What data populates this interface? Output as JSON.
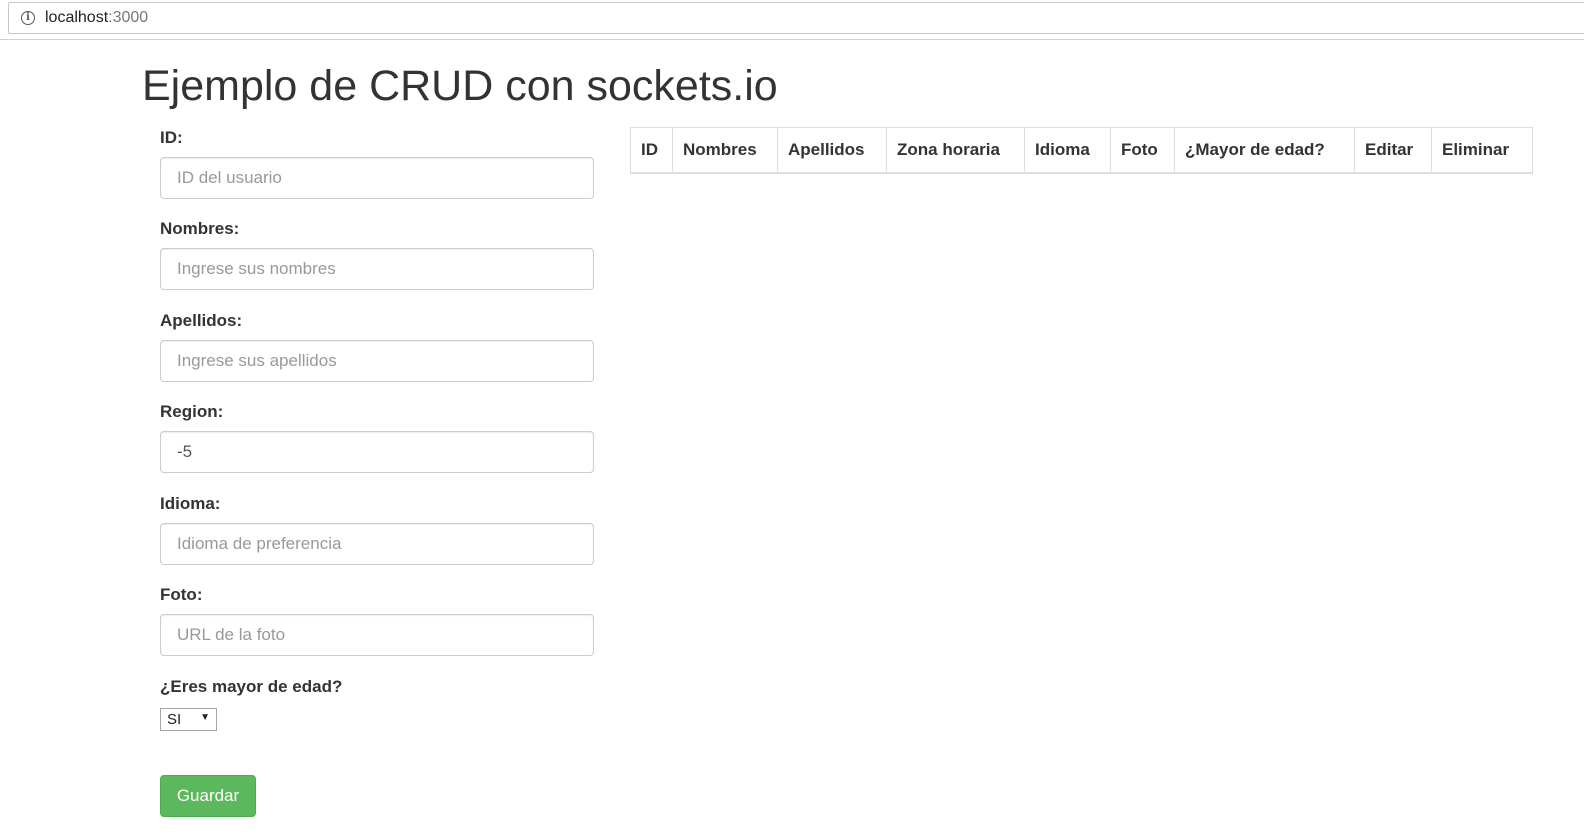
{
  "browser": {
    "url_host": "localhost",
    "url_port": ":3000"
  },
  "page": {
    "title": "Ejemplo de CRUD con sockets.io"
  },
  "form": {
    "id": {
      "label": "ID:",
      "placeholder": "ID del usuario",
      "value": ""
    },
    "nombres": {
      "label": "Nombres:",
      "placeholder": "Ingrese sus nombres",
      "value": ""
    },
    "apellidos": {
      "label": "Apellidos:",
      "placeholder": "Ingrese sus apellidos",
      "value": ""
    },
    "region": {
      "label": "Region:",
      "placeholder": "",
      "value": "-5"
    },
    "idioma": {
      "label": "Idioma:",
      "placeholder": "Idioma de preferencia",
      "value": ""
    },
    "foto": {
      "label": "Foto:",
      "placeholder": "URL de la foto",
      "value": ""
    },
    "mayor": {
      "label": "¿Eres mayor de edad?",
      "selected": "SI"
    },
    "save_label": "Guardar",
    "save_color": "#5cb85c"
  },
  "table": {
    "headers": [
      "ID",
      "Nombres",
      "Apellidos",
      "Zona horaria",
      "Idioma",
      "Foto",
      "¿Mayor de edad?",
      "Editar",
      "Eliminar"
    ],
    "rows": []
  }
}
